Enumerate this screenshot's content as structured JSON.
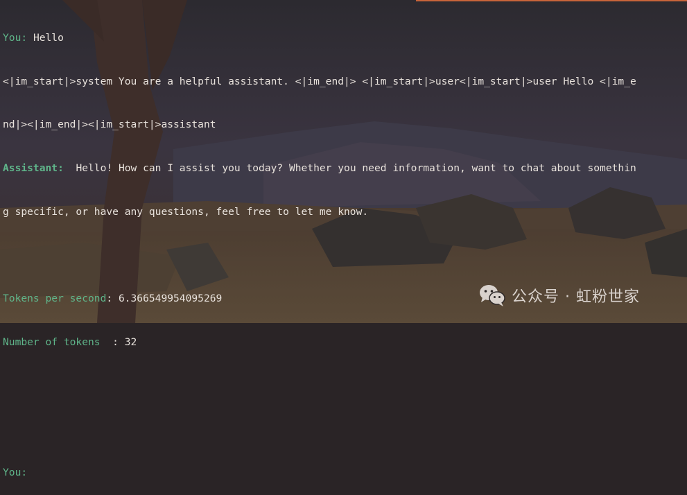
{
  "terminal": {
    "you_prompt_1": "You: ",
    "user_message": "Hello",
    "system_prompt_line1": "<|im_start|>system You are a helpful assistant. <|im_end|> <|im_start|>user<|im_start|>user Hello <|im_e",
    "system_prompt_line2": "nd|><|im_end|><|im_start|>assistant",
    "assistant_label": "Assistant:",
    "assistant_line1": "  Hello! How can I assist you today? Whether you need information, want to chat about somethin",
    "assistant_line2": "g specific, or have any questions, feel free to let me know.",
    "tps_label": "Tokens per second",
    "tps_value": ": 6.366549954095269",
    "tokens_label": "Number of tokens  ",
    "tokens_value": ": 32",
    "you_prompt_2": "You:"
  },
  "watermark": {
    "icon": "wechat-icon",
    "text": "公众号 · 虹粉世家"
  },
  "colors": {
    "prompt_green": "#5fb58a",
    "text": "#e8e2dc",
    "accent": "#c8643a"
  }
}
